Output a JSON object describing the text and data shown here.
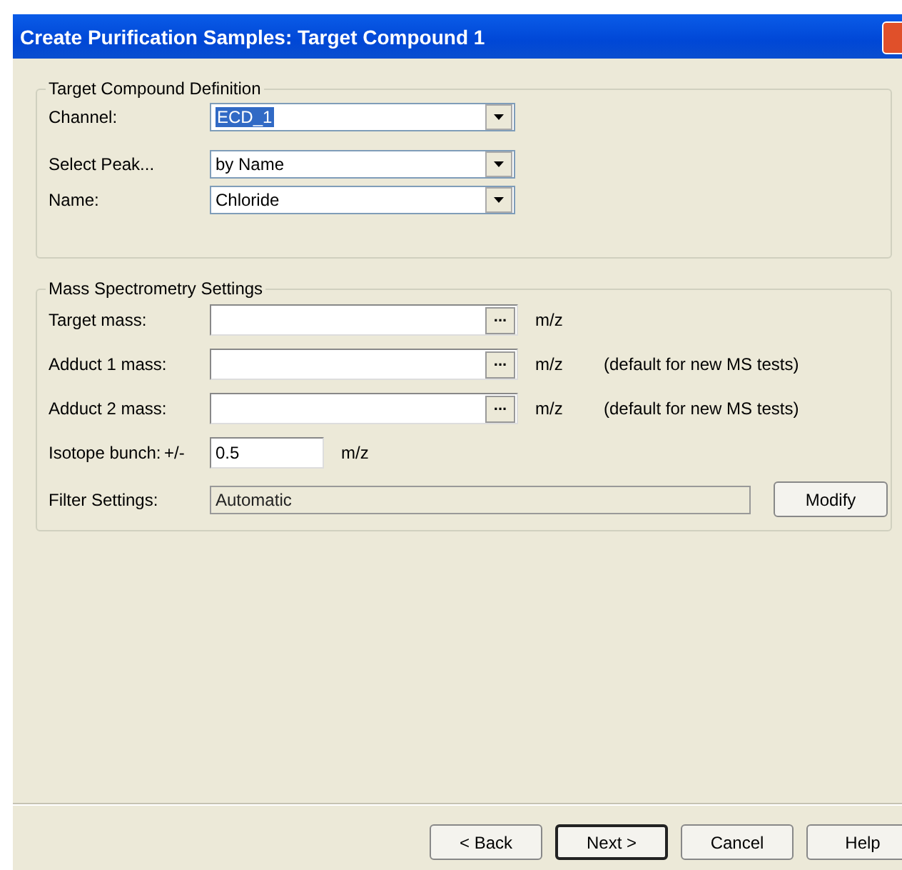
{
  "window": {
    "title": "Create Purification Samples: Target Compound 1"
  },
  "target_group": {
    "title": "Target Compound Definition",
    "fields": [
      {
        "label": "Channel:",
        "value": "ECD_1",
        "text_selected": true
      },
      {
        "label": "Select Peak...",
        "value": "by Name",
        "text_selected": false
      },
      {
        "label": "Name:",
        "value": "Chloride",
        "text_selected": false
      }
    ]
  },
  "ms_group": {
    "title": "Mass Spectrometry Settings",
    "mass_rows": [
      {
        "label": "Target mass:",
        "browse": "...",
        "unit": "m/z"
      },
      {
        "label": "Adduct 1 mass:",
        "browse": "...",
        "unit": "m/z",
        "note": "(default for new MS tests)"
      },
      {
        "label": "Adduct 2 mass:",
        "browse": "...",
        "unit": "m/z",
        "note": "(default for new MS tests)"
      }
    ],
    "isotope": {
      "label": "Isotope bunch:",
      "prefix": "+/-",
      "value": "0.5",
      "unit": "m/z"
    },
    "filter": {
      "label": "Filter Settings:",
      "value": "Automatic",
      "button": "Modify"
    }
  },
  "buttons": [
    {
      "label": "< Back",
      "default": false
    },
    {
      "label": "Next >",
      "default": true
    },
    {
      "label": "Cancel",
      "default": false
    },
    {
      "label": "Help",
      "default": false
    }
  ]
}
